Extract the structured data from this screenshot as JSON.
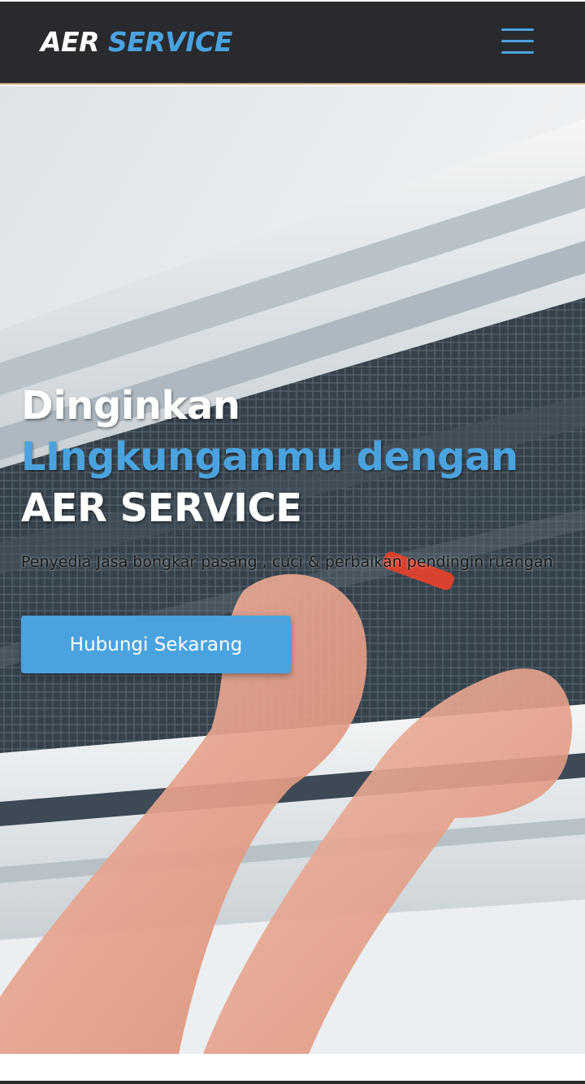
{
  "navbar": {
    "brand_part1": "AER",
    "brand_part2": "SERVICE",
    "menu_icon": "hamburger-menu-icon"
  },
  "hero": {
    "image": "technician-repairing-air-conditioner-photo",
    "headline_line1": "Dinginkan",
    "headline_line2": "LIngkunganmu dengan",
    "headline_line3": "AER SERVICE",
    "tagline": "Penyedia Jasa bongkar pasang , cuci & perbaikan pendingin ruangan",
    "cta_label": "Hubungi Sekarang"
  },
  "colors": {
    "navbar_bg": "#282a2d",
    "accent": "#4aa3df",
    "navbar_border": "#c9a27c"
  }
}
